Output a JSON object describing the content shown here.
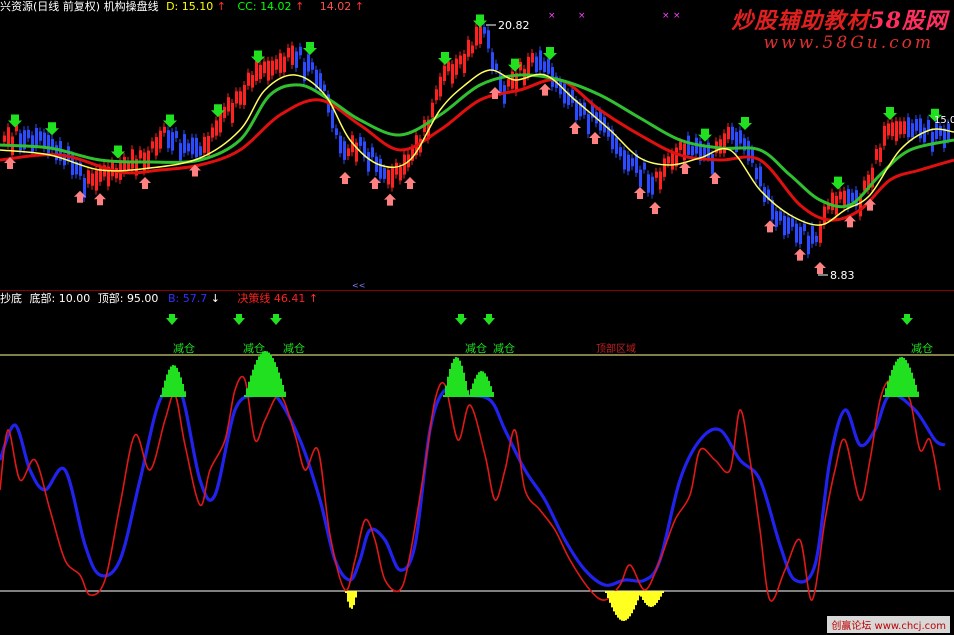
{
  "header": {
    "title": "兴资源(日线 前复权) 机构操盘线",
    "d_label": "D:",
    "d_value": "15.10",
    "d_arrow": "↑",
    "cc_label": "CC:",
    "cc_value": "14.02",
    "cc_arrow": "↑",
    "third_value": "14.02",
    "third_arrow": "↑"
  },
  "indicator_header": {
    "name": "抄底",
    "bottom_label": "底部:",
    "bottom_value": "10.00",
    "top_label": "顶部:",
    "top_value": "95.00",
    "blue_label": "B:",
    "blue_value": "57.7",
    "blue_arrow": "↓",
    "decision_label": "决策线",
    "decision_value": "46.41",
    "decision_arrow": "↑"
  },
  "watermark": {
    "line1_a": "炒股辅助教材",
    "line1_b": "58股网",
    "line2": "www.58Gu.com",
    "corner": "创赢论坛 www.chcj.com"
  },
  "price_labels": {
    "high": "20.82",
    "low": "8.83",
    "right": "15.0"
  },
  "signals": {
    "reduce": "减仓",
    "center_text": "顶部区域"
  },
  "colors": {
    "title": "#ffffff",
    "d": "#ffff00",
    "cc": "#00ff00",
    "third": "#ff5050",
    "bottom_top": "#ffffff",
    "blue": "#2a2aff",
    "decision": "#ff2020",
    "reduce": "#00ff00",
    "watermark": "#e02020"
  }
}
